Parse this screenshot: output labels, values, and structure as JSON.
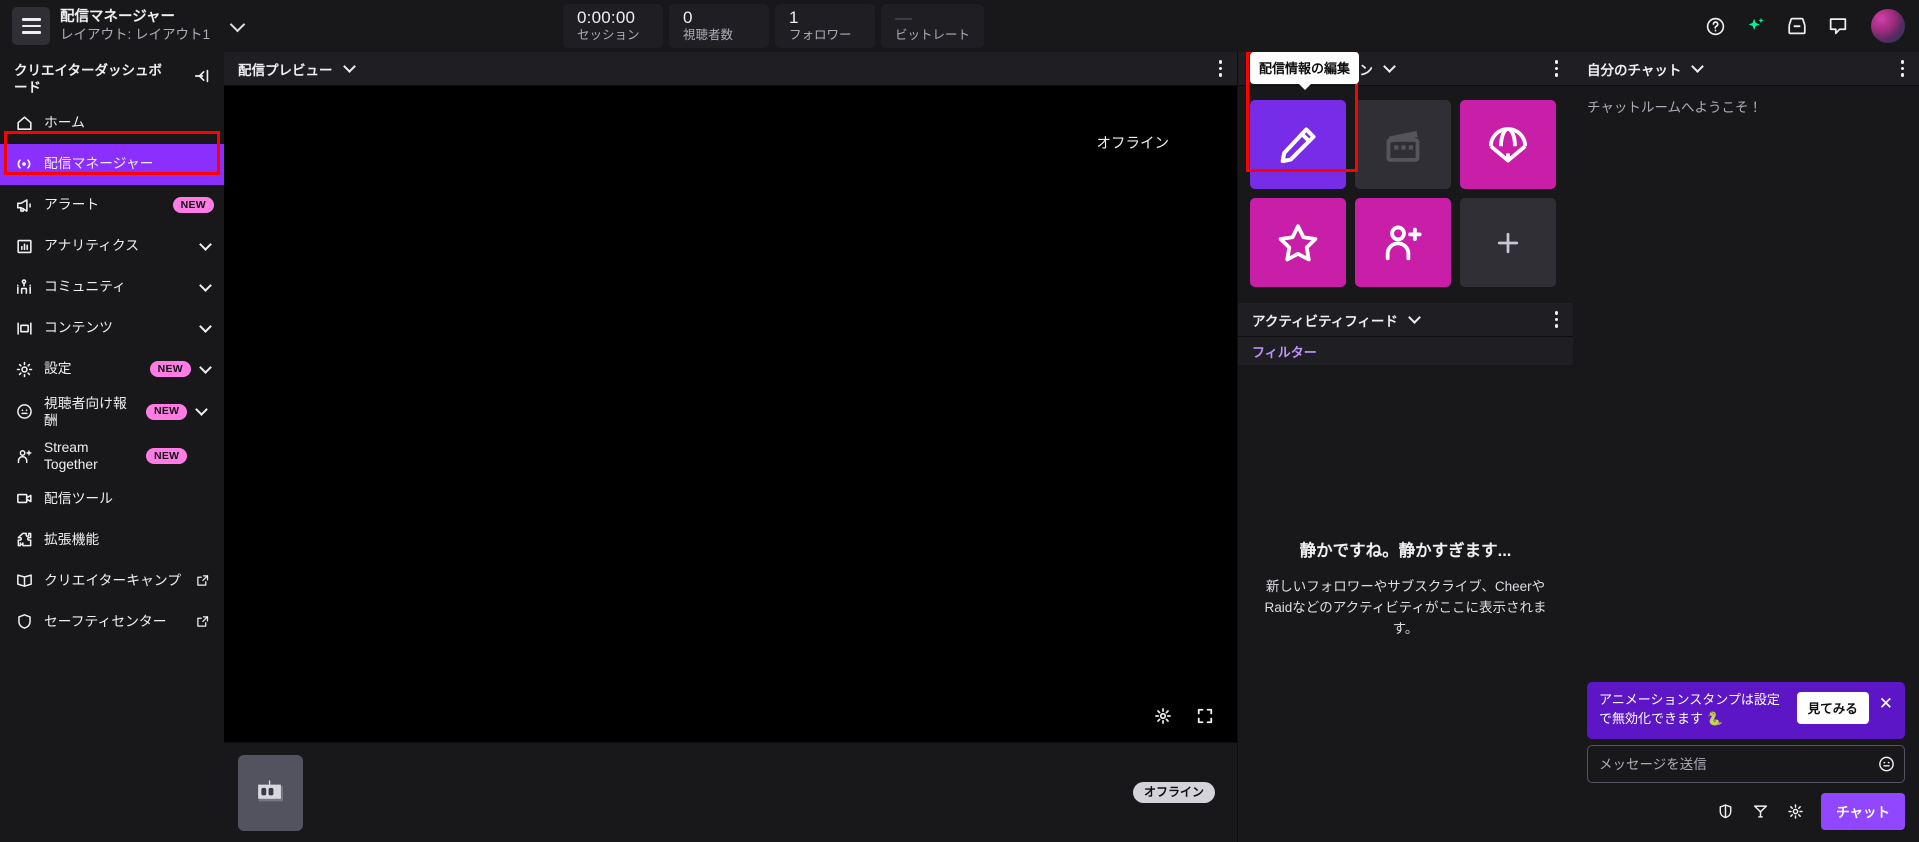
{
  "colors": {
    "brand_purple": "#9147ff",
    "active_nav": "#8b2fff",
    "tile_purple": "#772ce8",
    "tile_magenta": "#c91ea8",
    "tile_dark": "#2f2f35",
    "badge_pink": "#ff7ce5",
    "accent_link": "#bf94ff",
    "highlight_red": "#ff0000",
    "bg_page": "#0e0e10",
    "bg_panel": "#18181b",
    "bg_header": "#1f1f23",
    "promo_purple": "#5c16c5"
  },
  "topbar": {
    "menu_icon": "hamburger-icon",
    "title": "配信マネージャー",
    "subtitle": "レイアウト: レイアウト1",
    "caret_icon": "chevron-down-icon",
    "stats": [
      {
        "value": "0:00:00",
        "label": "セッション",
        "is_dash": false
      },
      {
        "value": "0",
        "label": "視聴者数",
        "is_dash": false
      },
      {
        "value": "1",
        "label": "フォロワー",
        "is_dash": false
      },
      {
        "value": "—",
        "label": "ビットレート",
        "is_dash": true
      }
    ],
    "icons": [
      {
        "name": "help-icon"
      },
      {
        "name": "sparkle-icon"
      },
      {
        "name": "inbox-icon"
      },
      {
        "name": "whispers-icon"
      }
    ],
    "avatar": "user-avatar"
  },
  "sidebar": {
    "header": "クリエイターダッシュボード",
    "collapse_icon": "collapse-sidebar-icon",
    "items": [
      {
        "label": "ホーム",
        "icon": "home-icon",
        "active": false,
        "badge": "",
        "chevron": false,
        "external": false
      },
      {
        "label": "配信マネージャー",
        "icon": "broadcast-icon",
        "active": true,
        "badge": "",
        "chevron": false,
        "external": false
      },
      {
        "label": "アラート",
        "icon": "megaphone-icon",
        "active": false,
        "badge": "NEW",
        "chevron": false,
        "external": false
      },
      {
        "label": "アナリティクス",
        "icon": "analytics-icon",
        "active": false,
        "badge": "",
        "chevron": true,
        "external": false
      },
      {
        "label": "コミュニティ",
        "icon": "community-icon",
        "active": false,
        "badge": "",
        "chevron": true,
        "external": false
      },
      {
        "label": "コンテンツ",
        "icon": "content-icon",
        "active": false,
        "badge": "",
        "chevron": true,
        "external": false
      },
      {
        "label": "設定",
        "icon": "gear-icon",
        "active": false,
        "badge": "NEW",
        "chevron": true,
        "external": false
      },
      {
        "label": "視聴者向け報酬",
        "icon": "smiley-icon",
        "active": false,
        "badge": "NEW",
        "chevron": true,
        "external": false
      },
      {
        "label": "Stream Together",
        "icon": "person-add-icon",
        "active": false,
        "badge": "NEW",
        "chevron": false,
        "external": false
      },
      {
        "label": "配信ツール",
        "icon": "video-camera-icon",
        "active": false,
        "badge": "",
        "chevron": false,
        "external": false
      },
      {
        "label": "拡張機能",
        "icon": "puzzle-icon",
        "active": false,
        "badge": "",
        "chevron": false,
        "external": false
      },
      {
        "label": "クリエイターキャンプ",
        "icon": "book-icon",
        "active": false,
        "badge": "",
        "chevron": false,
        "external": true
      },
      {
        "label": "セーフティセンター",
        "icon": "shield-icon",
        "active": false,
        "badge": "",
        "chevron": false,
        "external": true
      }
    ]
  },
  "preview": {
    "title": "配信プレビュー",
    "chevron_icon": "chevron-down-icon",
    "more_icon": "more-options-icon",
    "offline_label": "オフライン",
    "settings_icon": "stream-settings-icon",
    "fullscreen_icon": "fullscreen-icon",
    "channel_thumb_icon": "channel-avatar-icon",
    "channel_status": "オフライン"
  },
  "quick_actions": {
    "title": "クイックアクション",
    "chevron_icon": "chevron-down-icon",
    "more_icon": "more-options-icon",
    "tooltip": "配信情報の編集",
    "tiles": [
      {
        "name": "edit-stream-info-tile",
        "icon": "pencil-icon",
        "style": "purple",
        "highlighted": true
      },
      {
        "name": "create-clip-tile",
        "icon": "clapperboard-icon",
        "style": "dark",
        "highlighted": false
      },
      {
        "name": "drops-tile",
        "icon": "parachute-icon",
        "style": "magenta",
        "highlighted": false
      },
      {
        "name": "favorites-tile",
        "icon": "star-icon",
        "style": "magenta",
        "highlighted": false
      },
      {
        "name": "host-raid-tile",
        "icon": "person-add-icon",
        "style": "magenta",
        "highlighted": false
      },
      {
        "name": "add-action-tile",
        "icon": "plus-icon",
        "style": "dark",
        "highlighted": false
      }
    ]
  },
  "activity_feed": {
    "title": "アクティビティフィード",
    "chevron_icon": "chevron-down-icon",
    "more_icon": "more-options-icon",
    "filter_label": "フィルター",
    "empty_title": "静かですね。静かすぎます...",
    "empty_body": "新しいフォロワーやサブスクライブ、CheerやRaidなどのアクティビティがここに表示されます。"
  },
  "chat": {
    "title": "自分のチャット",
    "chevron_icon": "chevron-down-icon",
    "more_icon": "more-options-icon",
    "welcome": "チャットルームへようこそ！",
    "promo_text": "アニメーションスタンプは設定で無効化できます 🐍",
    "promo_button": "見てみる",
    "promo_close_icon": "close-icon",
    "input_placeholder": "メッセージを送信",
    "emote_icon": "emote-picker-icon",
    "footer_icons": [
      {
        "name": "mod-shield-icon"
      },
      {
        "name": "bits-icon"
      },
      {
        "name": "chat-settings-icon"
      }
    ],
    "send_button": "チャット"
  }
}
